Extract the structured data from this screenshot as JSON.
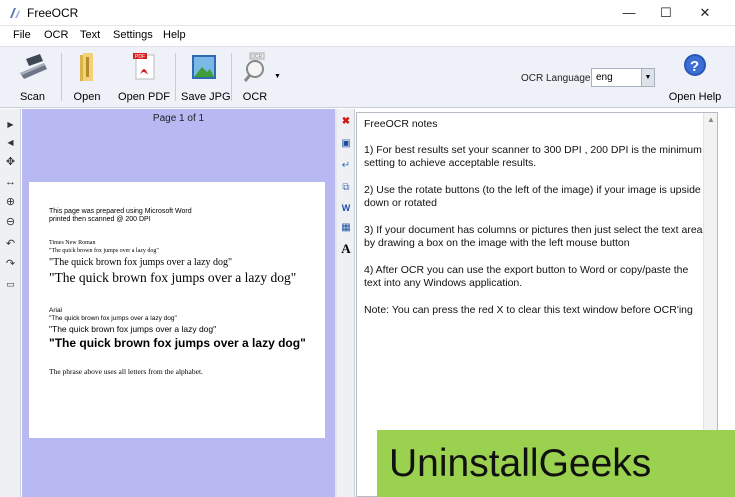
{
  "window": {
    "title": "FreeOCR",
    "minimize": "—",
    "maximize": "☐",
    "close": "✕"
  },
  "menu": [
    "File",
    "OCR",
    "Text",
    "Settings",
    "Help"
  ],
  "toolbar": {
    "scan": "Scan",
    "open": "Open",
    "open_pdf": "Open PDF",
    "save_jpg": "Save JPG",
    "ocr": "OCR",
    "ocr_language_label": "OCR Language:",
    "ocr_language_value": "eng",
    "open_help": "Open Help"
  },
  "image_pane": {
    "page_label": "Page 1 of 1",
    "doc": {
      "line1": "This page was prepared using Microsoft Word",
      "line2": "printed then scanned @ 200 DPI",
      "tnr_heading": "Times New Roman",
      "tnr_small": "\"The quick brown fox jumps over a lazy dog\"",
      "tnr_medium": "\"The quick brown fox jumps over a lazy dog\"",
      "tnr_large": "\"The quick brown fox jumps over a lazy dog\"",
      "arial_heading": "Arial",
      "arial_small": "\"The quick brown fox jumps over a lazy dog\"",
      "arial_medium": "\"The quick brown fox  jumps over a lazy dog\"",
      "arial_large": "\"The quick brown fox jumps over a lazy dog\"",
      "footer": "The phrase above uses all letters from the alphabet."
    }
  },
  "text_pane": {
    "heading": "FreeOCR notes",
    "p1": "1) For best results set your scanner to 300 DPI , 200 DPI is the minimum setting to achieve acceptable results.",
    "p2": "2) Use the rotate buttons (to the left of the image) if your image is upside down or rotated",
    "p3": "3) If your document has columns or pictures then just select the text area by drawing a box on the image with the left mouse button",
    "p4": "4) After OCR you can use the export button to Word or copy/paste the text into any Windows application.",
    "note": "Note: You can press the red X to clear this text window before OCR'ing"
  },
  "watermark": "UninstallGeeks",
  "colors": {
    "image_pane_bg": "#b8b8f2",
    "toolbar_bg": "#eef2f8",
    "watermark_bg": "#9ad14f"
  }
}
